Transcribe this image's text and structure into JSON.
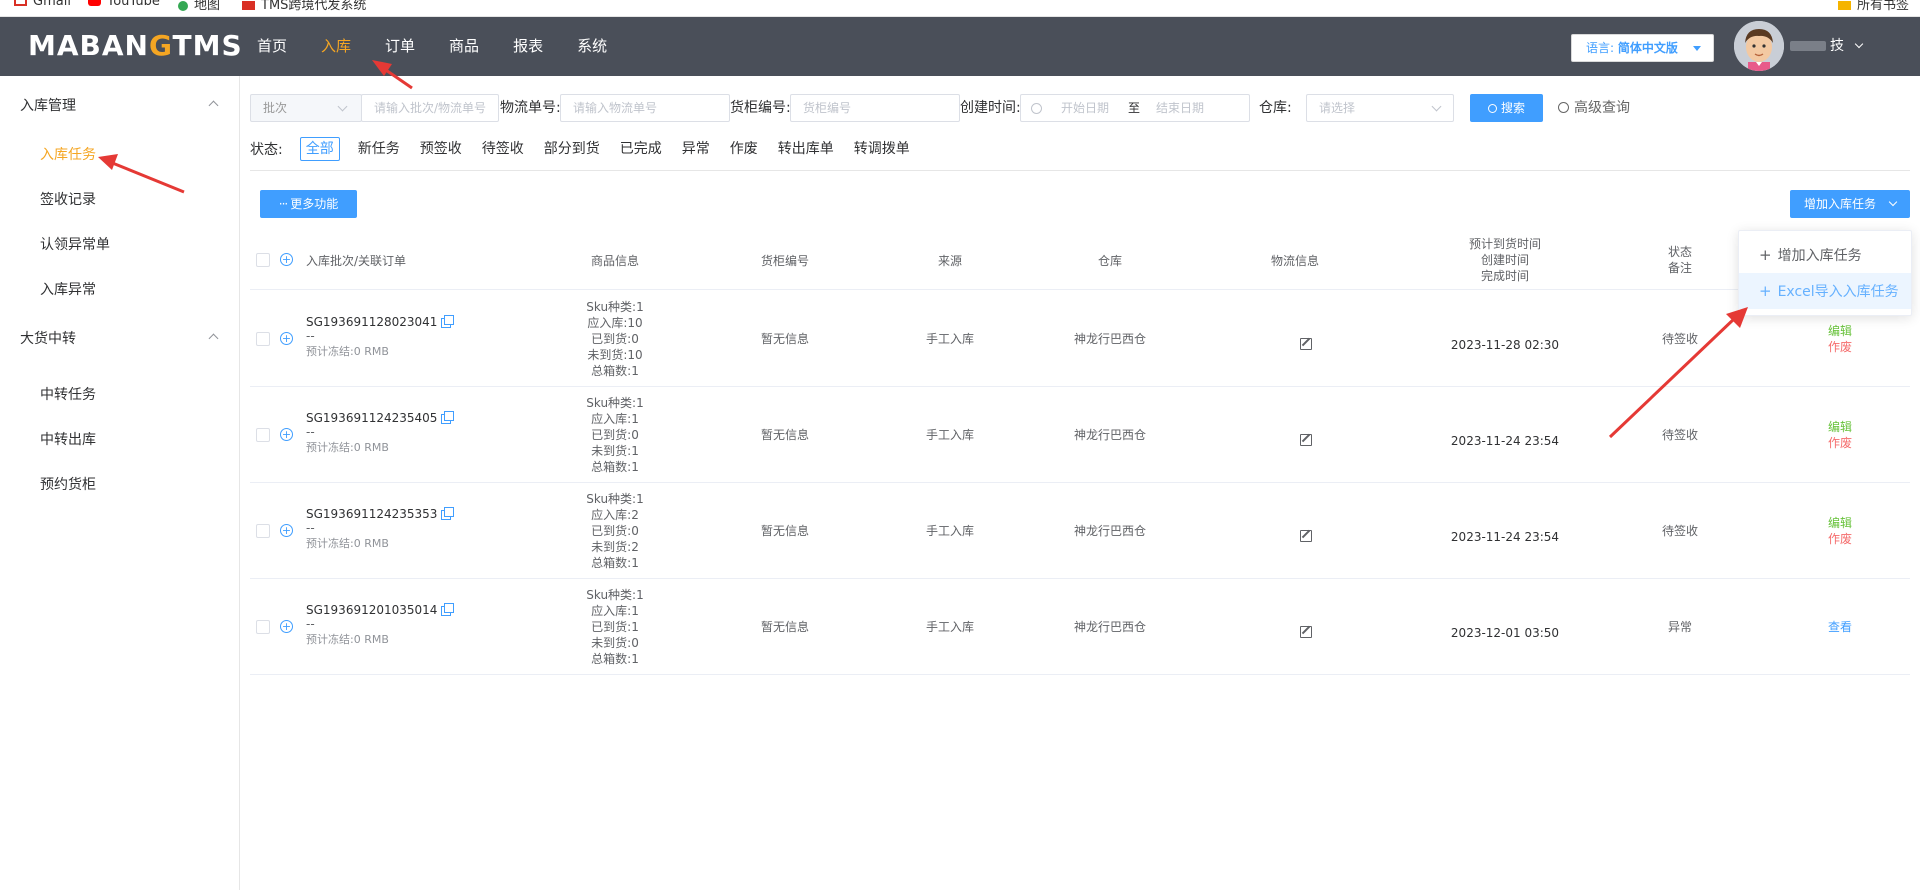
{
  "bookmarks": [
    {
      "label": "Gmail",
      "color": "#d93025"
    },
    {
      "label": "YouTube",
      "color": "#ff0000"
    },
    {
      "label": "地图",
      "color": "#34a853"
    },
    {
      "label": "TMS跨境代发系统",
      "color": "#d93025"
    },
    {
      "label": "所有书签",
      "color": "#f5b400"
    }
  ],
  "header": {
    "logo_left": "MABAN",
    "logo_o": "G",
    "logo_right": "TMS",
    "nav": [
      "首页",
      "入库",
      "订单",
      "商品",
      "报表",
      "系统"
    ],
    "nav_active": 1,
    "lang_label": "语言: ",
    "lang_value": "简体中文版",
    "username_suffix": "技"
  },
  "sidebar": {
    "groups": [
      {
        "label": "入库管理",
        "items": [
          "入库任务",
          "签收记录",
          "认领异常单",
          "入库异常"
        ]
      },
      {
        "label": "大货中转",
        "items": [
          "中转任务",
          "中转出库",
          "预约货柜"
        ]
      }
    ],
    "active_item": "入库任务"
  },
  "filters": {
    "batch_select": "批次",
    "batch_placeholder": "请输入批次/物流单号",
    "tracking_label": "物流单号:",
    "tracking_placeholder": "请输入物流单号",
    "container_label": "货柜编号:",
    "container_placeholder": "货柜编号",
    "created_label": "创建时间:",
    "start_placeholder": "开始日期",
    "to": "至",
    "end_placeholder": "结束日期",
    "warehouse_label": "仓库:",
    "warehouse_placeholder": "请选择",
    "search_btn": "搜索",
    "advanced": "高级查询"
  },
  "status": {
    "label": "状态:",
    "chips": [
      "全部",
      "新任务",
      "预签收",
      "待签收",
      "部分到货",
      "已完成",
      "异常",
      "作废",
      "转出库单",
      "转调拨单"
    ],
    "active": 0
  },
  "toolbar": {
    "more_btn": "更多功能",
    "add_btn": "增加入库任务"
  },
  "dropdown": {
    "items": [
      "增加入库任务",
      "Excel导入入库任务"
    ],
    "hovered": 1
  },
  "table": {
    "headers": {
      "order": "入库批次/关联订单",
      "goods": "商品信息",
      "container": "货柜编号",
      "source": "来源",
      "warehouse": "仓库",
      "logistics": "物流信息",
      "time1": "预计到货时间",
      "time2": "创建时间",
      "time3": "完成时间",
      "status1": "状态",
      "status2": "备注"
    },
    "rows": [
      {
        "no": "SG193691128023041",
        "dash": "--",
        "freeze": "预计冻结:0 RMB",
        "goods": [
          "Sku种类:1",
          "应入库:10",
          "已到货:0",
          "未到货:10",
          "总箱数:1"
        ],
        "container": "暂无信息",
        "source": "手工入库",
        "warehouse": "神龙行巴西仓",
        "time": "2023-11-28 02:30",
        "status": "待签收",
        "actions": [
          {
            "label": "编辑",
            "color": "green"
          },
          {
            "label": "作废",
            "color": "red"
          }
        ]
      },
      {
        "no": "SG193691124235405",
        "dash": "--",
        "freeze": "预计冻结:0 RMB",
        "goods": [
          "Sku种类:1",
          "应入库:1",
          "已到货:0",
          "未到货:1",
          "总箱数:1"
        ],
        "container": "暂无信息",
        "source": "手工入库",
        "warehouse": "神龙行巴西仓",
        "time": "2023-11-24 23:54",
        "status": "待签收",
        "actions": [
          {
            "label": "编辑",
            "color": "green"
          },
          {
            "label": "作废",
            "color": "red"
          }
        ]
      },
      {
        "no": "SG193691124235353",
        "dash": "--",
        "freeze": "预计冻结:0 RMB",
        "goods": [
          "Sku种类:1",
          "应入库:2",
          "已到货:0",
          "未到货:2",
          "总箱数:1"
        ],
        "container": "暂无信息",
        "source": "手工入库",
        "warehouse": "神龙行巴西仓",
        "time": "2023-11-24 23:54",
        "status": "待签收",
        "actions": [
          {
            "label": "编辑",
            "color": "green"
          },
          {
            "label": "作废",
            "color": "red"
          }
        ]
      },
      {
        "no": "SG193691201035014",
        "dash": "--",
        "freeze": "预计冻结:0 RMB",
        "goods": [
          "Sku种类:1",
          "应入库:1",
          "已到货:1",
          "未到货:0",
          "总箱数:1"
        ],
        "container": "暂无信息",
        "source": "手工入库",
        "warehouse": "神龙行巴西仓",
        "time": "2023-12-01 03:50",
        "status": "异常",
        "actions": [
          {
            "label": "查看",
            "color": "blue"
          }
        ]
      }
    ]
  },
  "colors": {
    "topbar": "#4a4f59",
    "accent": "#f5a623",
    "primary": "#409eff",
    "annotation_arrow": "#e53935"
  }
}
